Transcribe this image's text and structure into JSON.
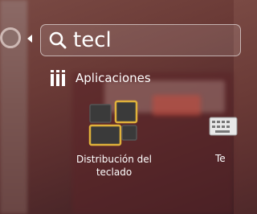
{
  "search": {
    "value": "tecl",
    "placeholder": ""
  },
  "section": {
    "label": "Aplicaciones"
  },
  "results": [
    {
      "label": "Distribución del\nteclado",
      "icon": "keyboard-layout-icon"
    },
    {
      "label": "Te",
      "icon": "keyboard-icon"
    }
  ],
  "colors": {
    "text": "#ffffff",
    "icon_accent": "#e0b23a",
    "icon_dark": "#3a3a3a"
  }
}
